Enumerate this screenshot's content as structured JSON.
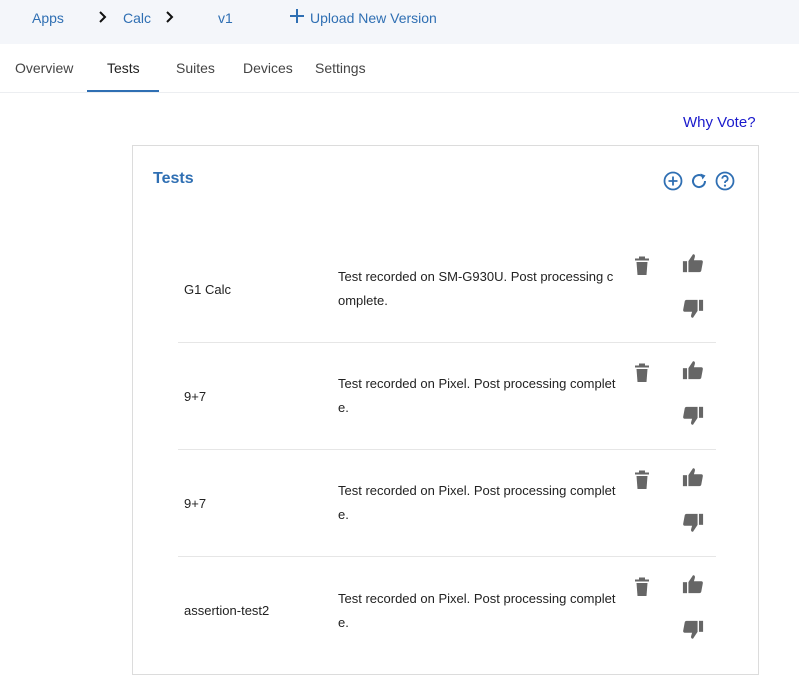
{
  "breadcrumb": {
    "apps": "Apps",
    "app": "Calc",
    "version": "v1",
    "upload": "Upload New Version"
  },
  "tabs": [
    {
      "label": "Overview",
      "active": false
    },
    {
      "label": "Tests",
      "active": true
    },
    {
      "label": "Suites",
      "active": false
    },
    {
      "label": "Devices",
      "active": false
    },
    {
      "label": "Settings",
      "active": false
    }
  ],
  "why_vote": "Why Vote?",
  "panel": {
    "title": "Tests",
    "icons": [
      "add-circle-icon",
      "refresh-icon",
      "help-circle-icon"
    ]
  },
  "tests": [
    {
      "name": "G1 Calc",
      "status": "Test recorded on SM-G930U. Post processing complete."
    },
    {
      "name": "9+7",
      "status": "Test recorded on Pixel. Post processing complete."
    },
    {
      "name": "9+7",
      "status": "Test recorded on Pixel. Post processing complete."
    },
    {
      "name": "assertion-test2",
      "status": "Test recorded on Pixel. Post processing complete."
    }
  ],
  "colors": {
    "accent": "#2f6fb3",
    "link": "#1a1acc",
    "icon_gray": "#666666"
  }
}
